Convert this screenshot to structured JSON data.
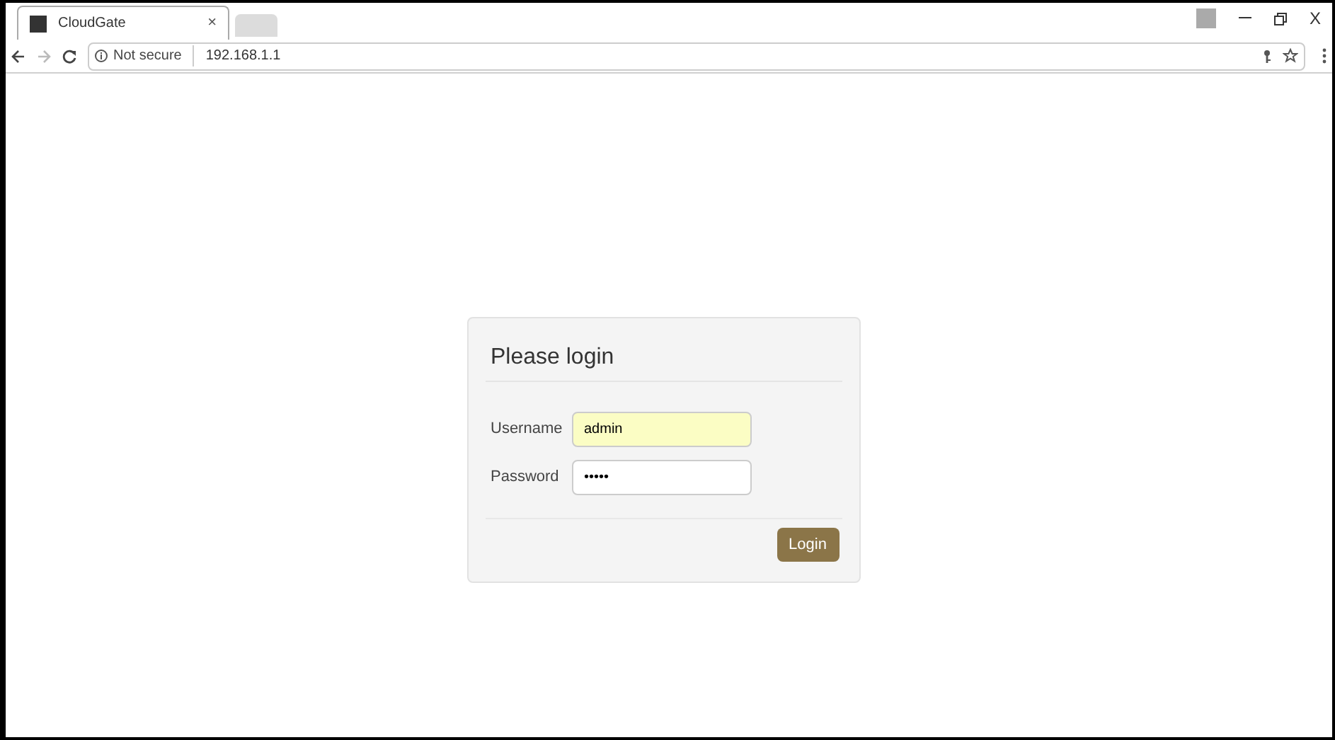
{
  "browser": {
    "tabs": [
      {
        "title": "CloudGate",
        "close": "×",
        "selected": true
      }
    ],
    "address_bar": {
      "security": "Not secure",
      "url": "192.168.1.1"
    },
    "window_controls": {
      "close": "X"
    }
  },
  "login": {
    "title": "Please login",
    "fields": [
      {
        "label": "Username",
        "value": "admin",
        "autofilled": true
      },
      {
        "label": "Password",
        "value": "•••••",
        "autofilled": false
      }
    ],
    "button": "Login"
  }
}
